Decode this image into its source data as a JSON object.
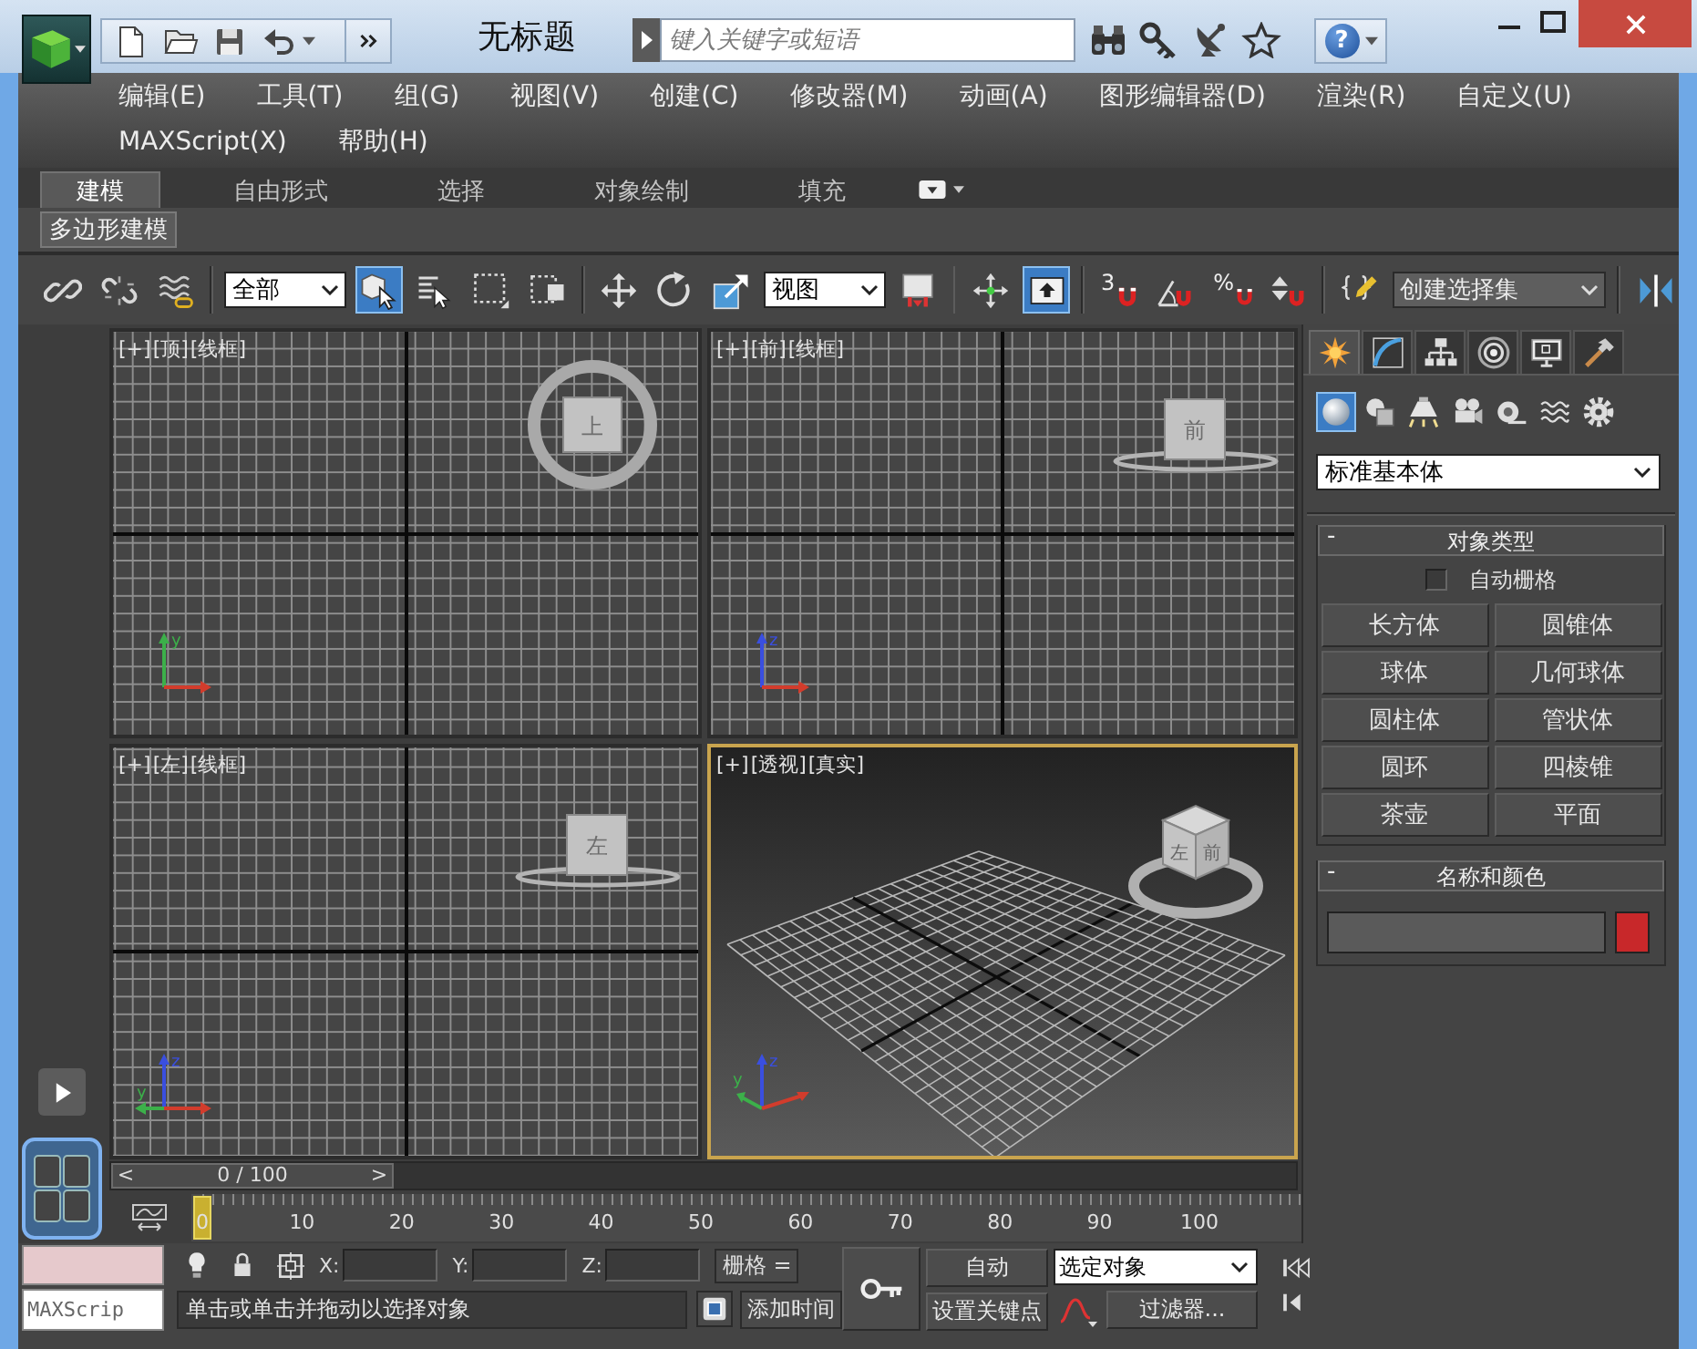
{
  "title_bar": {
    "title": "无标题",
    "search": {
      "placeholder": "键入关键字或短语"
    },
    "help": "?"
  },
  "menu_bar": {
    "items": [
      "编辑(E)",
      "工具(T)",
      "组(G)",
      "视图(V)",
      "创建(C)",
      "修改器(M)",
      "动画(A)",
      "图形编辑器(D)",
      "渲染(R)",
      "自定义(U)",
      "MAXScript(X)",
      "帮助(H)"
    ]
  },
  "ribbon": {
    "tabs": [
      {
        "label": "建模",
        "selected": true
      },
      {
        "label": "自由形式",
        "selected": false
      },
      {
        "label": "选择",
        "selected": false
      },
      {
        "label": "对象绘制",
        "selected": false
      },
      {
        "label": "填充",
        "selected": false
      }
    ],
    "panel": "多边形建模"
  },
  "main_toolbar": {
    "items": [
      {
        "kind": "link",
        "on": false
      },
      {
        "kind": "unlink",
        "on": false
      },
      {
        "kind": "bind",
        "on": false
      },
      {
        "kind": "dropdown",
        "value": "全部"
      },
      {
        "kind": "select",
        "on": true
      },
      {
        "kind": "select_by_name",
        "on": false
      },
      {
        "kind": "rect_region",
        "on": false
      },
      {
        "kind": "crossing",
        "on": false
      },
      {
        "kind": "move",
        "on": false
      },
      {
        "kind": "rotate",
        "on": false
      },
      {
        "kind": "scale",
        "on": false
      },
      {
        "kind": "dropdown",
        "value": "视图"
      },
      {
        "kind": "pivot",
        "on": false
      },
      {
        "kind": "manipulate",
        "on": false
      },
      {
        "kind": "shortcut_override",
        "on": true
      },
      {
        "kind": "snap",
        "label": "3",
        "on": false
      },
      {
        "kind": "angle_snap",
        "on": false
      },
      {
        "kind": "percent_snap",
        "label": "%",
        "on": false
      },
      {
        "kind": "spinner_snap",
        "on": false
      },
      {
        "kind": "named_sets",
        "on": false
      },
      {
        "kind": "combo",
        "value": "创建选择集"
      },
      {
        "kind": "mirror",
        "on": false
      }
    ]
  },
  "viewports": [
    {
      "kind": "top",
      "active": false,
      "labels": [
        "[+]",
        "[顶]",
        "[线框]"
      ],
      "viewcube": [
        "上"
      ],
      "axes": [
        {
          "kind": "up",
          "label": "y",
          "color": "#3cb04a"
        },
        {
          "kind": "right",
          "color": "#d23c2c"
        }
      ]
    },
    {
      "kind": "front",
      "active": false,
      "labels": [
        "[+]",
        "[前]",
        "[线框]"
      ],
      "viewcube": [
        "前"
      ],
      "axes": [
        {
          "kind": "up",
          "label": "z",
          "color": "#3a4fe0"
        },
        {
          "kind": "right",
          "color": "#d23c2c"
        }
      ]
    },
    {
      "kind": "left",
      "active": false,
      "labels": [
        "[+]",
        "[左]",
        "[线框]"
      ],
      "viewcube": [
        "左"
      ],
      "axes": [
        {
          "kind": "up",
          "label": "z",
          "color": "#3a4fe0"
        },
        {
          "kind": "left",
          "label": "y",
          "color": "#3cb04a"
        },
        {
          "kind": "right",
          "color": "#d23c2c"
        }
      ]
    },
    {
      "kind": "perspective",
      "active": true,
      "labels": [
        "[+]",
        "[透视]",
        "[真实]"
      ],
      "viewcube": [
        "左",
        "前"
      ],
      "axes": [
        {
          "kind": "up",
          "label": "z",
          "color": "#3a4fe0"
        },
        {
          "kind": "up_left",
          "label": "y",
          "color": "#3cb04a"
        },
        {
          "kind": "up_right",
          "color": "#d23c2c"
        }
      ]
    }
  ],
  "command_panel": {
    "tabs": [
      {
        "kind": "create",
        "selected": true
      },
      {
        "kind": "modify",
        "selected": false
      },
      {
        "kind": "hierarchy",
        "selected": false
      },
      {
        "kind": "motion",
        "selected": false
      },
      {
        "kind": "display",
        "selected": false
      },
      {
        "kind": "utilities",
        "selected": false
      }
    ],
    "categories": [
      {
        "kind": "geometry",
        "selected": true
      },
      {
        "kind": "shapes",
        "selected": false
      },
      {
        "kind": "lights",
        "selected": false
      },
      {
        "kind": "cameras",
        "selected": false
      },
      {
        "kind": "helpers",
        "selected": false
      },
      {
        "kind": "space_warps",
        "selected": false
      },
      {
        "kind": "systems",
        "selected": false
      }
    ],
    "type_dropdown": "标准基本体",
    "rollouts": [
      {
        "kind": "object_type",
        "toggle": "-",
        "title": "对象类型",
        "auto_grid": {
          "label": "自动栅格",
          "checked": false
        },
        "buttons": [
          "长方体",
          "圆锥体",
          "球体",
          "几何球体",
          "圆柱体",
          "管状体",
          "圆环",
          "四棱锥",
          "茶壶",
          "平面"
        ]
      },
      {
        "kind": "name_color",
        "toggle": "-",
        "title": "名称和颜色",
        "color": "#c8282a"
      }
    ]
  },
  "time_slider": {
    "prev": "<",
    "label": "0 / 100",
    "next": ">",
    "level": 0
  },
  "track_bar": {
    "labels": [
      "0",
      "10",
      "20",
      "30",
      "40",
      "50",
      "60",
      "70",
      "80",
      "90",
      "100"
    ]
  },
  "status_bar": {
    "listener_input": "MAXScrip",
    "coordinates": [
      "X:",
      "Y:",
      "Z:"
    ],
    "grid": "栅格 =",
    "prompt": "单击或单击并拖动以选择对象",
    "add_time_tag": "添加时间",
    "auto_key": "自动",
    "set_key": "设置关键点",
    "key_mode": "选定对象",
    "filters": "过滤器..."
  }
}
